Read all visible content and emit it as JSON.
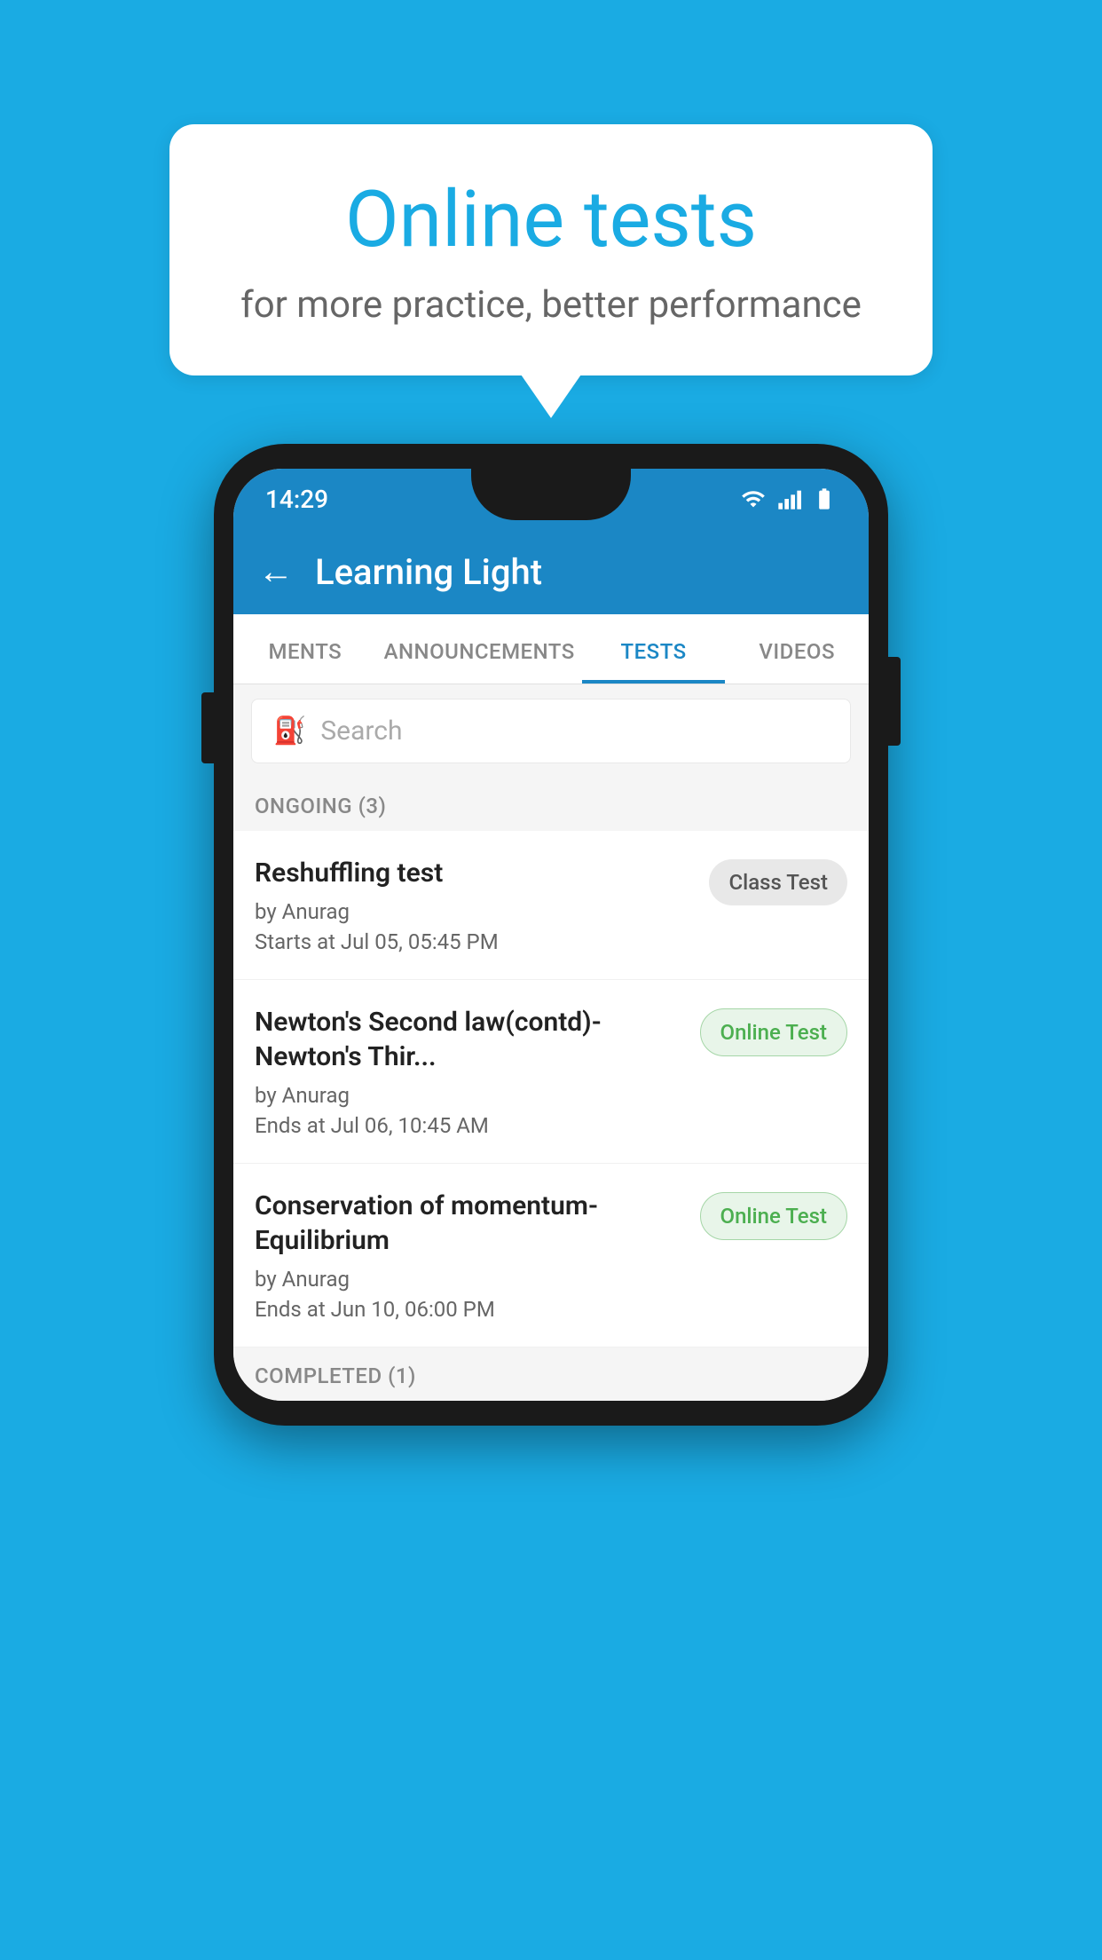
{
  "background_color": "#1AABE3",
  "bubble": {
    "title": "Online tests",
    "subtitle": "for more practice, better performance"
  },
  "phone": {
    "status_bar": {
      "time": "14:29",
      "icons": [
        "wifi",
        "signal",
        "battery"
      ]
    },
    "header": {
      "title": "Learning Light",
      "back_label": "←"
    },
    "tabs": [
      {
        "label": "MENTS",
        "active": false
      },
      {
        "label": "ANNOUNCEMENTS",
        "active": false
      },
      {
        "label": "TESTS",
        "active": true
      },
      {
        "label": "VIDEOS",
        "active": false
      }
    ],
    "search": {
      "placeholder": "Search"
    },
    "ongoing_section": {
      "label": "ONGOING (3)"
    },
    "tests": [
      {
        "name": "Reshuffling test",
        "author": "by Anurag",
        "date": "Starts at  Jul 05, 05:45 PM",
        "badge": "Class Test",
        "badge_type": "class"
      },
      {
        "name": "Newton's Second law(contd)-Newton's Thir...",
        "author": "by Anurag",
        "date": "Ends at  Jul 06, 10:45 AM",
        "badge": "Online Test",
        "badge_type": "online"
      },
      {
        "name": "Conservation of momentum-Equilibrium",
        "author": "by Anurag",
        "date": "Ends at  Jun 10, 06:00 PM",
        "badge": "Online Test",
        "badge_type": "online"
      }
    ],
    "completed_section": {
      "label": "COMPLETED (1)"
    }
  }
}
